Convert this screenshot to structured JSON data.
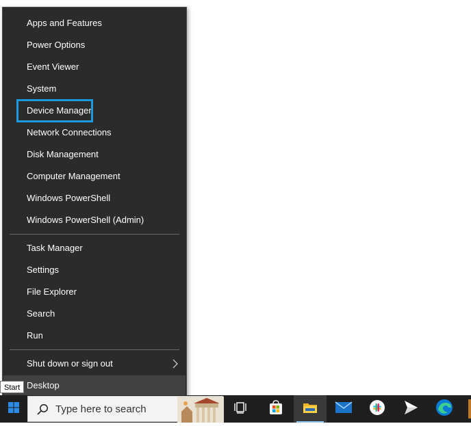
{
  "menu": {
    "groups": [
      [
        "Apps and Features",
        "Power Options",
        "Event Viewer",
        "System",
        "Device Manager",
        "Network Connections",
        "Disk Management",
        "Computer Management",
        "Windows PowerShell",
        "Windows PowerShell (Admin)"
      ],
      [
        "Task Manager",
        "Settings",
        "File Explorer",
        "Search",
        "Run"
      ],
      [
        "Shut down or sign out",
        "Desktop"
      ]
    ],
    "highlighted": "Device Manager",
    "hovered": "Desktop",
    "submenu_item": "Shut down or sign out"
  },
  "tooltip": {
    "text": "Start"
  },
  "taskbar": {
    "search_placeholder": "Type here to search",
    "pinned": [
      "task-view",
      "microsoft-store",
      "file-explorer",
      "mail",
      "slack",
      "send",
      "edge"
    ],
    "active_app": "file-explorer"
  },
  "colors": {
    "menu_bg": "#2b2b2b",
    "focus_ring": "#1b9ae0",
    "taskbar_bg": "#1f1f1f",
    "start_blue": "#2d8ae6"
  }
}
